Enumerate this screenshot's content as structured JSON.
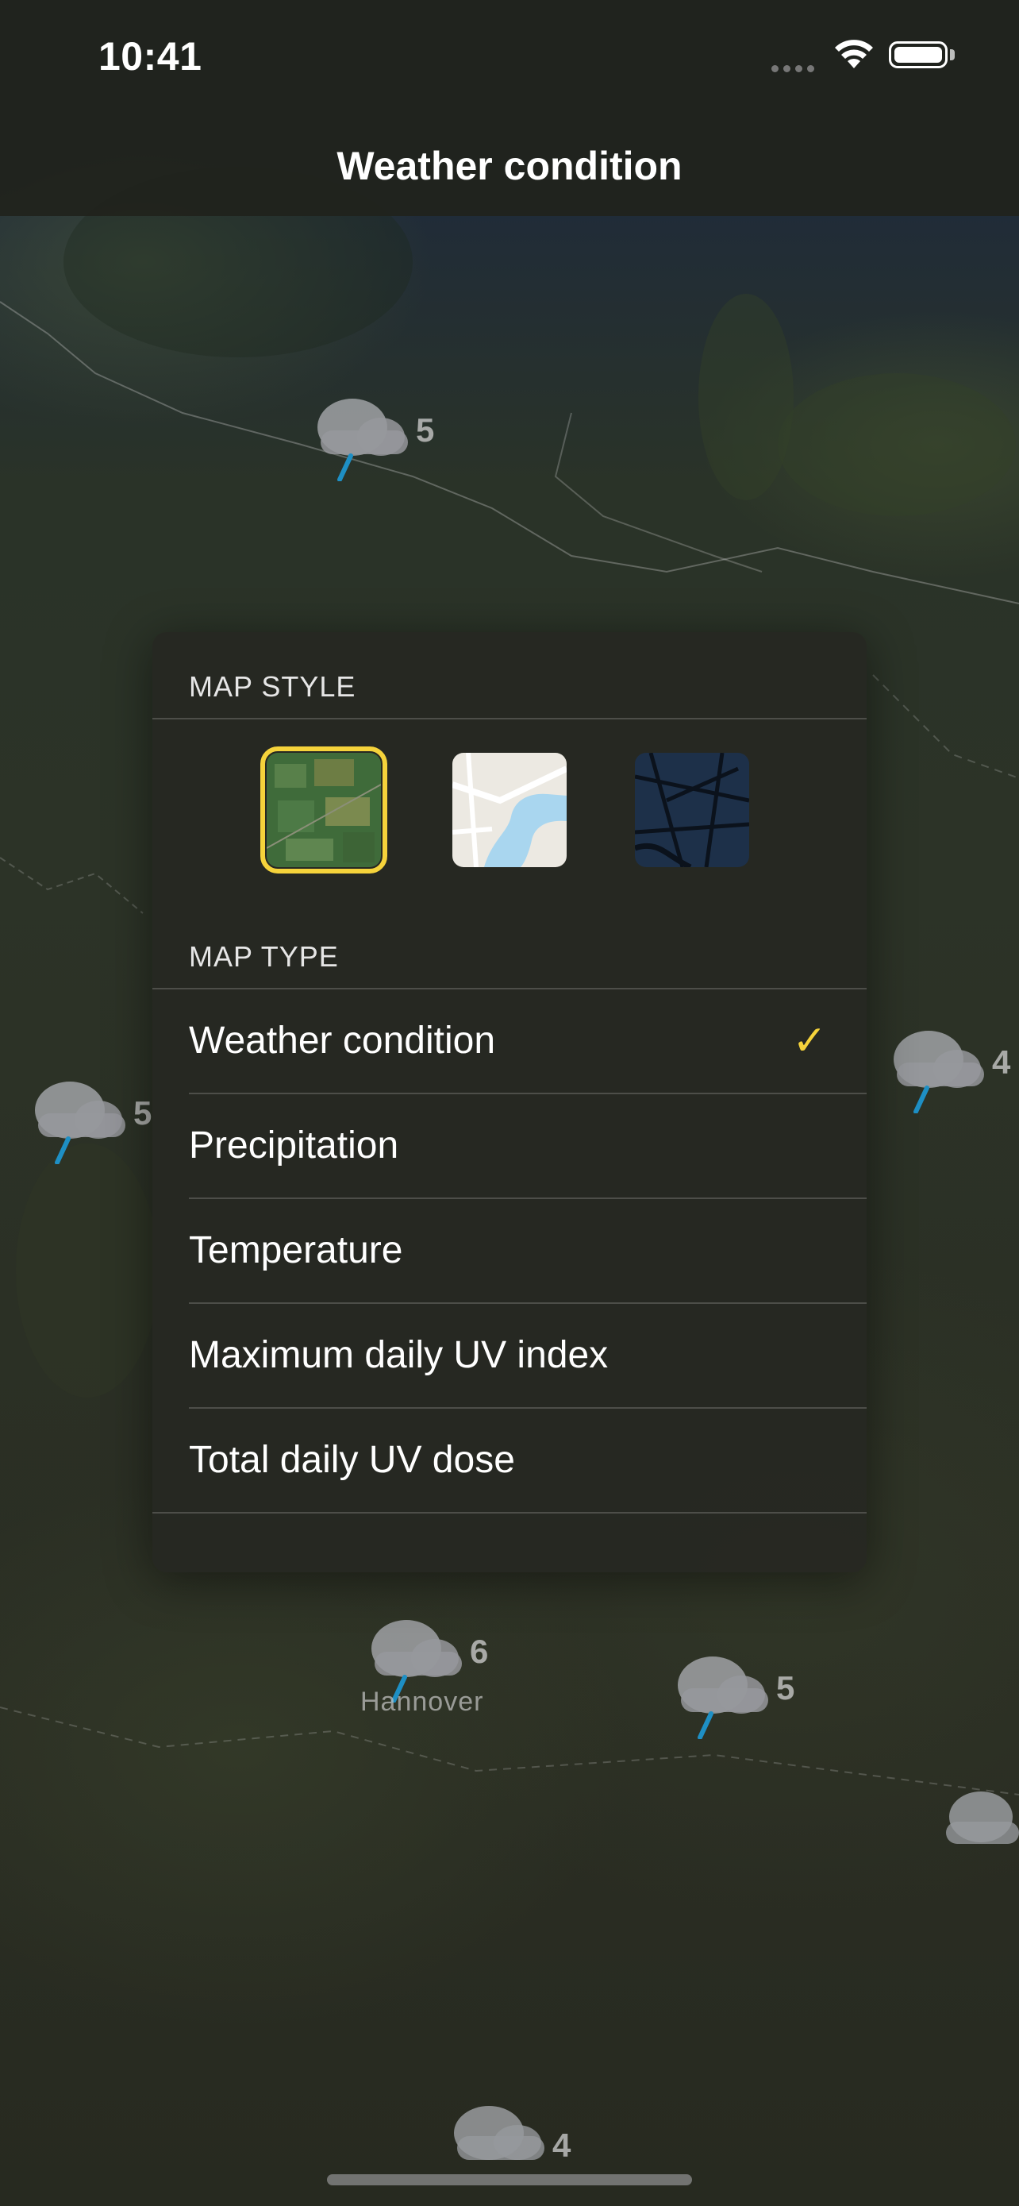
{
  "status_bar": {
    "time": "10:41"
  },
  "nav": {
    "title": "Weather condition"
  },
  "map": {
    "markers": [
      {
        "value": "5"
      },
      {
        "value": "4"
      },
      {
        "value": "5"
      },
      {
        "value": "6"
      },
      {
        "value": "5"
      },
      {
        "value": "4"
      }
    ],
    "cities": {
      "hannover": "Hannover"
    }
  },
  "panel": {
    "map_style_header": "MAP STYLE",
    "map_styles": [
      {
        "name": "satellite-style-icon",
        "selected": true
      },
      {
        "name": "light-map-style-icon",
        "selected": false
      },
      {
        "name": "dark-map-style-icon",
        "selected": false
      }
    ],
    "map_type_header": "MAP TYPE",
    "map_types": [
      {
        "label": "Weather condition",
        "selected": true
      },
      {
        "label": "Precipitation",
        "selected": false
      },
      {
        "label": "Temperature",
        "selected": false
      },
      {
        "label": "Maximum daily UV index",
        "selected": false
      },
      {
        "label": "Total daily UV dose",
        "selected": false
      }
    ],
    "check_glyph": "✓"
  },
  "colors": {
    "accent": "#f5d33b",
    "panel_bg": "#262822"
  }
}
